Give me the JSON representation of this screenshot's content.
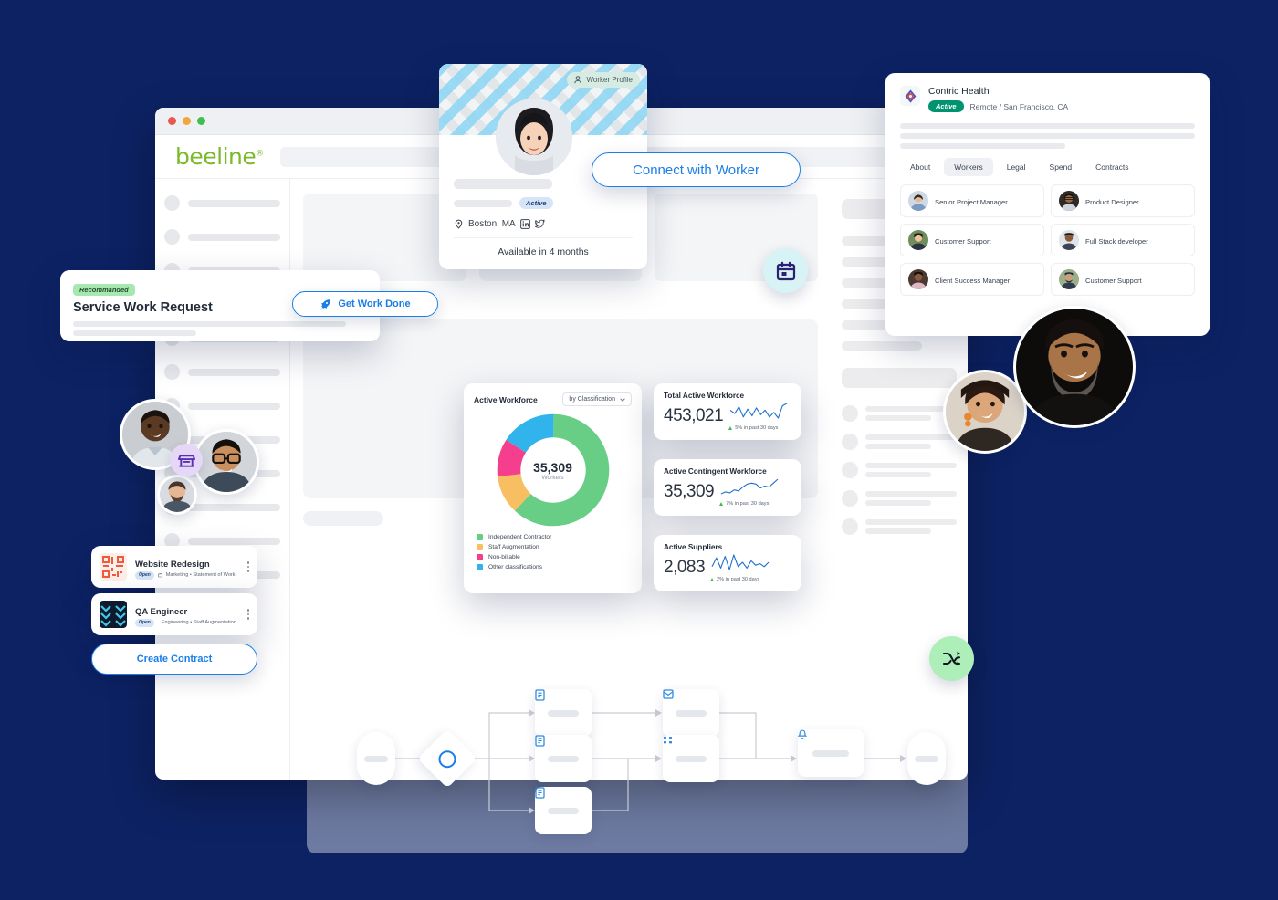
{
  "theme": {
    "navy": "#0d2263",
    "brand_green": "#7ab929",
    "accent_blue": "#1a7ee8",
    "status_green": "#00936f"
  },
  "browser": {
    "traffic_lights": [
      "close",
      "minimize",
      "zoom"
    ],
    "logo_text": "beeline",
    "logo_mark": "®",
    "search_placeholder": ""
  },
  "worker_profile": {
    "chip_label": "Worker Profile",
    "chip_icon": "person-icon",
    "status_badge": "Active",
    "location": "Boston, MA",
    "location_icon": "map-pin-icon",
    "social": [
      "linkedin-icon",
      "twitter-icon"
    ],
    "availability": "Available in 4 months",
    "connect_button": "Connect with Worker"
  },
  "company_card": {
    "logo_icon": "contric-logo-icon",
    "name": "Contric Health",
    "status_badge": "Active",
    "subtitle": "Remote / San Francisco, CA",
    "tabs": [
      {
        "label": "About",
        "active": false
      },
      {
        "label": "Workers",
        "active": true
      },
      {
        "label": "Legal",
        "active": false
      },
      {
        "label": "Spend",
        "active": false
      },
      {
        "label": "Contracts",
        "active": false
      }
    ],
    "workers": [
      {
        "role": "Senior Project Manager"
      },
      {
        "role": "Product Designer"
      },
      {
        "role": "Customer Support"
      },
      {
        "role": "Full Stack developer"
      },
      {
        "role": "Client Success Manager"
      },
      {
        "role": "Customer Support"
      }
    ]
  },
  "service_request": {
    "badge": "Recommanded",
    "title": "Service Work Request",
    "cta_label": "Get Work Done",
    "cta_icon": "rocket-icon"
  },
  "chart_data": {
    "type": "pie",
    "title": "Active Workforce",
    "selector_label": "by Classification",
    "selector_icon": "chevron-down-icon",
    "center_value": "35,309",
    "center_label": "Workers",
    "categories": [
      "Independent Contractor",
      "Staff Augmentation",
      "Non-billable",
      "Other classifications"
    ],
    "values": [
      62,
      11,
      11,
      16
    ],
    "colors": [
      "#68ce85",
      "#f8bf62",
      "#f53f8e",
      "#31b4ec"
    ],
    "legend_position": "bottom",
    "donut": true
  },
  "kpis": [
    {
      "title": "Total Active Workforce",
      "value": "453,021",
      "delta": "5% in past 30 days",
      "trend_icon": "triangle-up-icon",
      "sparkline": [
        10,
        7,
        13,
        4,
        11,
        5,
        12,
        6,
        10,
        4,
        8,
        3,
        14,
        16
      ]
    },
    {
      "title": "Active Contingent Workforce",
      "value": "35,309",
      "delta": "7% in past 30 days",
      "trend_icon": "triangle-up-icon",
      "sparkline": [
        2,
        4,
        3,
        6,
        5,
        9,
        12,
        13,
        12,
        8,
        10,
        9,
        13,
        17
      ]
    },
    {
      "title": "Active Suppliers",
      "value": "2,083",
      "delta": "2% in past 30 days",
      "trend_icon": "triangle-up-icon",
      "sparkline": [
        6,
        12,
        5,
        13,
        4,
        14,
        6,
        9,
        5,
        10,
        7,
        8,
        6,
        9
      ]
    }
  ],
  "projects": [
    {
      "name": "Website Redesign",
      "status": "Open",
      "category_icon": "briefcase-icon",
      "meta": "Marketing  •  Statement of Work",
      "menu_icon": "kebab-menu-icon",
      "thumb_color": "#f05a3c"
    },
    {
      "name": "QA Engineer",
      "status": "Open",
      "category_icon": "briefcase-icon",
      "meta": "Engineering  •  Staff Augmentation",
      "menu_icon": "kebab-menu-icon",
      "thumb_color": "#1b2b4d"
    }
  ],
  "create_contract_button": "Create Contract",
  "floating_actions": [
    {
      "name": "calendar",
      "icon": "calendar-icon",
      "bg": "#d8f3f6"
    },
    {
      "name": "shuffle",
      "icon": "shuffle-icon",
      "bg": "#aeeeb8"
    }
  ],
  "avatar_badge": {
    "icon": "storefront-icon",
    "bg": "#e4d8f6"
  },
  "workflow": {
    "start_node": "start",
    "decision_node": "decision",
    "nodes": [
      {
        "icon": "document-icon"
      },
      {
        "icon": "document-icon"
      },
      {
        "icon": "document-icon"
      },
      {
        "icon": "inbox-icon"
      },
      {
        "icon": "grid-icon"
      },
      {
        "icon": "bell-icon"
      }
    ],
    "end_node": "end"
  }
}
